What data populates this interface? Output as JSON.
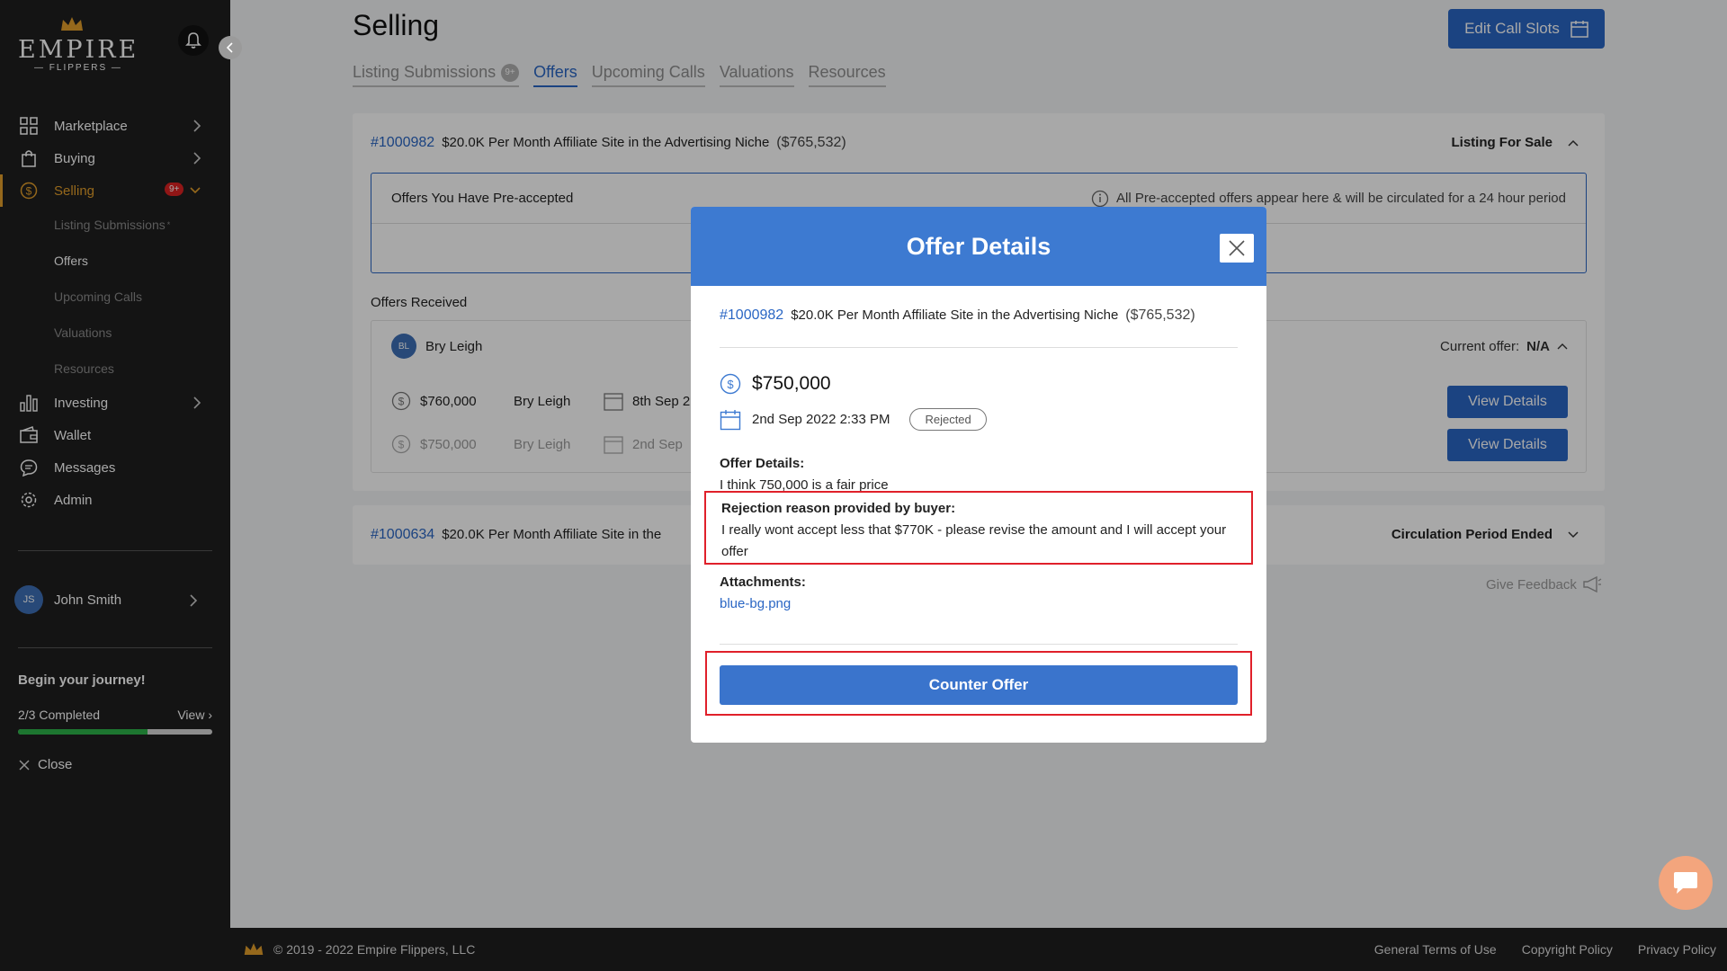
{
  "sidebar": {
    "logo": {
      "brand": "EMPIRE",
      "sub": "— FLIPPERS —"
    },
    "items": [
      {
        "label": "Marketplace"
      },
      {
        "label": "Buying"
      },
      {
        "label": "Selling",
        "badge": "9+"
      },
      {
        "label": "Investing"
      },
      {
        "label": "Wallet"
      },
      {
        "label": "Messages"
      },
      {
        "label": "Admin"
      }
    ],
    "selling_sub": [
      {
        "label": "Listing Submissions",
        "mark": "*"
      },
      {
        "label": "Offers"
      },
      {
        "label": "Upcoming Calls"
      },
      {
        "label": "Valuations"
      },
      {
        "label": "Resources"
      }
    ],
    "user": {
      "initials": "JS",
      "name": "John Smith"
    },
    "journey": {
      "title": "Begin your journey!",
      "progress_text": "2/3 Completed",
      "view_label": "View",
      "progress_fraction": 0.6667
    },
    "close_label": "Close"
  },
  "header": {
    "title": "Selling",
    "edit_slots_label": "Edit Call Slots",
    "tabs": [
      {
        "label": "Listing Submissions",
        "count": "9+"
      },
      {
        "label": "Offers"
      },
      {
        "label": "Upcoming Calls"
      },
      {
        "label": "Valuations"
      },
      {
        "label": "Resources"
      }
    ]
  },
  "listing1": {
    "id": "#1000982",
    "title": "$20.0K Per Month Affiliate Site in the Advertising Niche",
    "price": "($765,532)",
    "status": "Listing For Sale",
    "preaccepted_title": "Offers You Have Pre-accepted",
    "preaccepted_info": "All Pre-accepted offers appear here & will be circulated for a 24 hour period",
    "offers_received_label": "Offers Received",
    "buyer_initials": "BL",
    "buyer_name": "Bry Leigh",
    "current_offer_label": "Current offer:",
    "current_offer_value": "N/A",
    "offers": [
      {
        "amount": "$760,000",
        "name": "Bry Leigh",
        "date": "8th Sep 2",
        "button": "View Details"
      },
      {
        "amount": "$750,000",
        "name": "Bry Leigh",
        "date": "2nd Sep",
        "button": "View Details"
      }
    ]
  },
  "listing2": {
    "id": "#1000634",
    "title": "$20.0K Per Month Affiliate Site in the",
    "status": "Circulation Period Ended"
  },
  "feedback_label": "Give Feedback",
  "footer": {
    "copyright": "© 2019 - 2022 Empire Flippers, LLC",
    "links": [
      "General Terms of Use",
      "Copyright Policy",
      "Privacy Policy"
    ]
  },
  "modal": {
    "title": "Offer Details",
    "listing_id": "#1000982",
    "listing_title": "$20.0K Per Month Affiliate Site in the Advertising Niche",
    "listing_price": "($765,532)",
    "amount": "$750,000",
    "datetime": "2nd Sep 2022 2:33 PM",
    "status": "Rejected",
    "details_label": "Offer Details:",
    "details_text": "I think 750,000 is a fair price",
    "rejection_label": "Rejection reason provided by buyer:",
    "rejection_text": "I really wont accept less that $770K - please revise the amount and I will accept your offer",
    "attachments_label": "Attachments:",
    "attachment_file": "blue-bg.png",
    "counter_label": "Counter Offer"
  },
  "colors": {
    "accent": "#2a66c4",
    "brand_gold": "#e39f2b",
    "highlight": "#e0202a",
    "modal_header": "#3d7ad1"
  }
}
